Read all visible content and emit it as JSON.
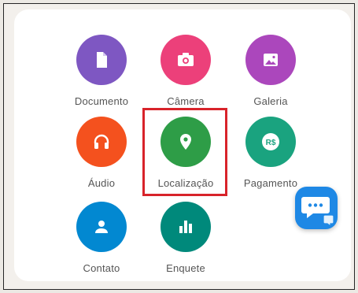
{
  "attach_menu": {
    "items": [
      {
        "label": "Documento",
        "icon": "document-icon",
        "color": "#7e57c2"
      },
      {
        "label": "Câmera",
        "icon": "camera-icon",
        "color": "#ec407a"
      },
      {
        "label": "Galeria",
        "icon": "gallery-icon",
        "color": "#ab47bc"
      },
      {
        "label": "Áudio",
        "icon": "headphones-icon",
        "color": "#f4511e"
      },
      {
        "label": "Localização",
        "icon": "location-pin-icon",
        "color": "#2e9d47"
      },
      {
        "label": "Pagamento",
        "icon": "payment-icon",
        "color": "#1aa37f"
      },
      {
        "label": "Contato",
        "icon": "contact-icon",
        "color": "#0288d1"
      },
      {
        "label": "Enquete",
        "icon": "poll-icon",
        "color": "#00897b"
      }
    ],
    "highlighted_item": "Localização",
    "highlight_color": "#d8232a"
  },
  "chat_fab": {
    "icon": "chat-bubble-icon",
    "color": "#1e88e5"
  }
}
